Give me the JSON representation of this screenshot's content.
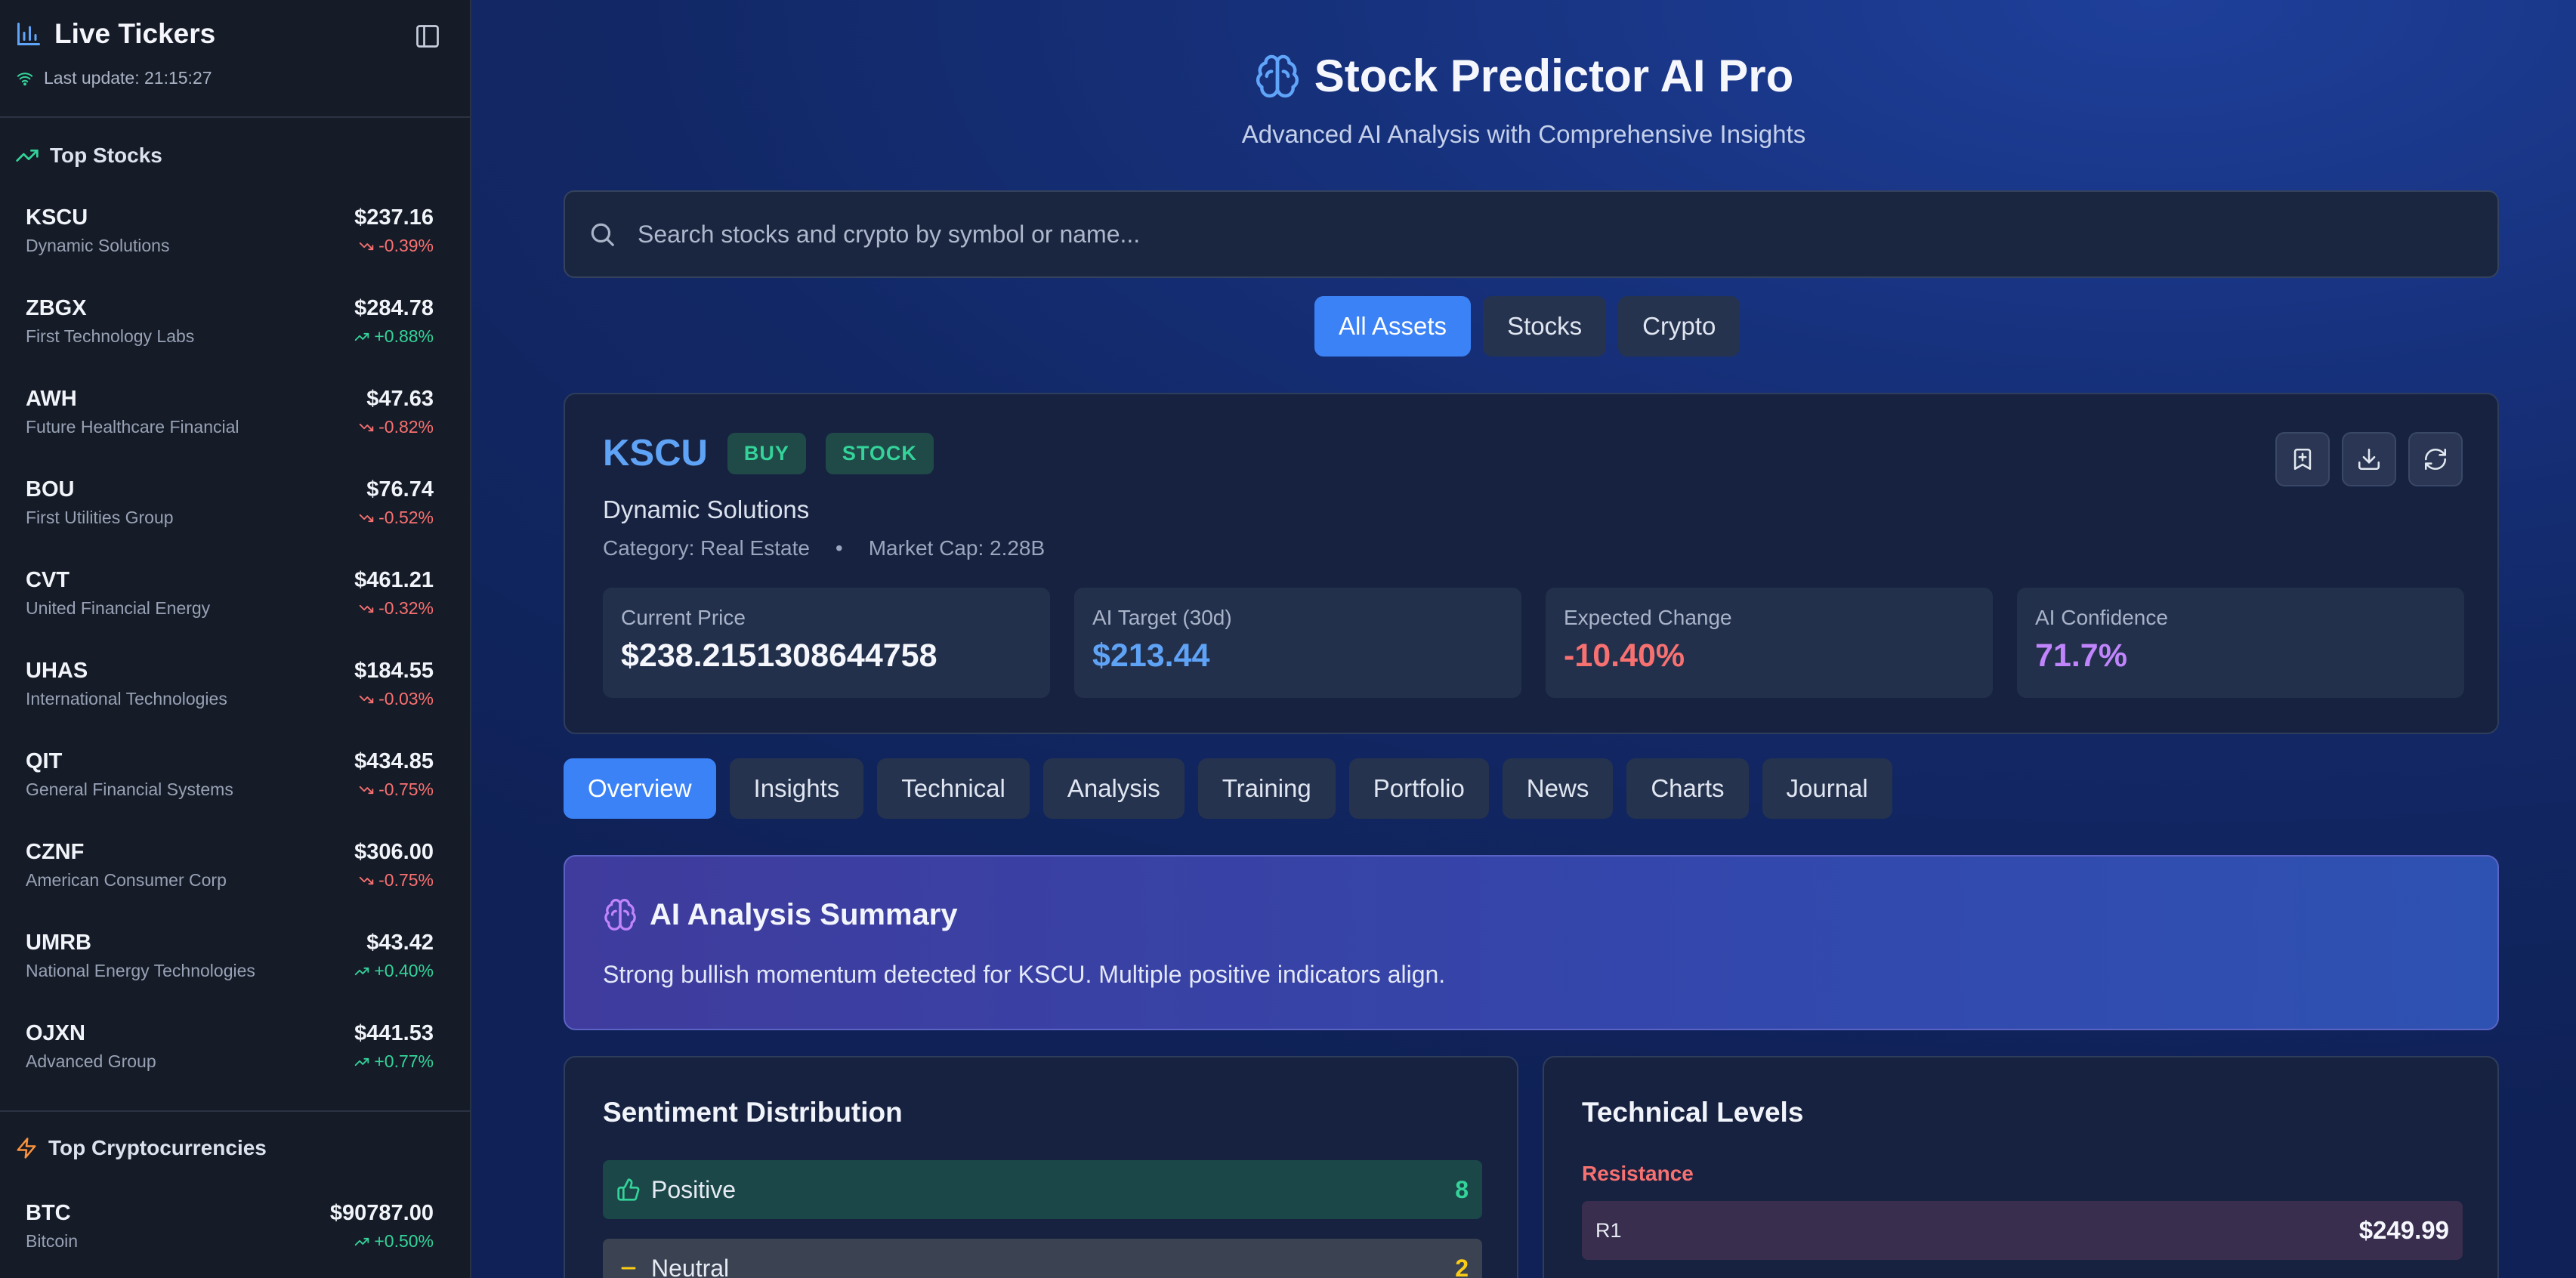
{
  "sidebar": {
    "title": "Live Tickers",
    "last_update": "Last update: 21:15:27",
    "stocks_title": "Top Stocks",
    "crypto_title": "Top Cryptocurrencies",
    "stocks": [
      {
        "symbol": "KSCU",
        "name": "Dynamic Solutions",
        "price": "$237.16",
        "change": "-0.39%",
        "direction": "down"
      },
      {
        "symbol": "ZBGX",
        "name": "First Technology Labs",
        "price": "$284.78",
        "change": "+0.88%",
        "direction": "up"
      },
      {
        "symbol": "AWH",
        "name": "Future Healthcare Financial",
        "price": "$47.63",
        "change": "-0.82%",
        "direction": "down"
      },
      {
        "symbol": "BOU",
        "name": "First Utilities Group",
        "price": "$76.74",
        "change": "-0.52%",
        "direction": "down"
      },
      {
        "symbol": "CVT",
        "name": "United Financial Energy",
        "price": "$461.21",
        "change": "-0.32%",
        "direction": "down"
      },
      {
        "symbol": "UHAS",
        "name": "International Technologies",
        "price": "$184.55",
        "change": "-0.03%",
        "direction": "down"
      },
      {
        "symbol": "QIT",
        "name": "General Financial Systems",
        "price": "$434.85",
        "change": "-0.75%",
        "direction": "down"
      },
      {
        "symbol": "CZNF",
        "name": "American Consumer Corp",
        "price": "$306.00",
        "change": "-0.75%",
        "direction": "down"
      },
      {
        "symbol": "UMRB",
        "name": "National Energy Technologies",
        "price": "$43.42",
        "change": "+0.40%",
        "direction": "up"
      },
      {
        "symbol": "OJXN",
        "name": "Advanced Group",
        "price": "$441.53",
        "change": "+0.77%",
        "direction": "up"
      }
    ],
    "crypto": [
      {
        "symbol": "BTC",
        "name": "Bitcoin",
        "price": "$90787.00",
        "change": "+0.50%",
        "direction": "up"
      }
    ]
  },
  "header": {
    "title": "Stock Predictor AI Pro",
    "subtitle": "Advanced AI Analysis with Comprehensive Insights"
  },
  "search": {
    "placeholder": "Search stocks and crypto by symbol or name...",
    "value": ""
  },
  "filters": [
    {
      "label": "All Assets",
      "active": true
    },
    {
      "label": "Stocks",
      "active": false
    },
    {
      "label": "Crypto",
      "active": false
    }
  ],
  "asset": {
    "symbol": "KSCU",
    "signal": "BUY",
    "type": "STOCK",
    "name": "Dynamic Solutions",
    "category": "Category: Real Estate",
    "separator": "•",
    "market_cap": "Market Cap: 2.28B",
    "stats": [
      {
        "label": "Current Price",
        "value": "$238.2151308644758",
        "color": "#f5f7fc"
      },
      {
        "label": "AI Target (30d)",
        "value": "$213.44",
        "color": "#5fa3f7"
      },
      {
        "label": "Expected Change",
        "value": "-10.40%",
        "color": "#f87171"
      },
      {
        "label": "AI Confidence",
        "value": "71.7%",
        "color": "#c084fc"
      }
    ]
  },
  "tabs": [
    {
      "label": "Overview",
      "active": true
    },
    {
      "label": "Insights",
      "active": false
    },
    {
      "label": "Technical",
      "active": false
    },
    {
      "label": "Analysis",
      "active": false
    },
    {
      "label": "Training",
      "active": false
    },
    {
      "label": "Portfolio",
      "active": false
    },
    {
      "label": "News",
      "active": false
    },
    {
      "label": "Charts",
      "active": false
    },
    {
      "label": "Journal",
      "active": false
    }
  ],
  "summary": {
    "title": "AI Analysis Summary",
    "text": "Strong bullish momentum detected for KSCU. Multiple positive indicators align."
  },
  "sentiment": {
    "title": "Sentiment Distribution",
    "rows": [
      {
        "label": "Positive",
        "count": "8",
        "color": "#34d399"
      },
      {
        "label": "Neutral",
        "count": "2",
        "color": "#facc15"
      }
    ]
  },
  "technical": {
    "title": "Technical Levels",
    "resistance_label": "Resistance",
    "levels": [
      {
        "name": "R1",
        "value": "$249.99"
      }
    ]
  },
  "colors": {
    "accent": "#3b82f6",
    "up": "#34d399",
    "down": "#f87171",
    "confidence": "#c084fc"
  }
}
